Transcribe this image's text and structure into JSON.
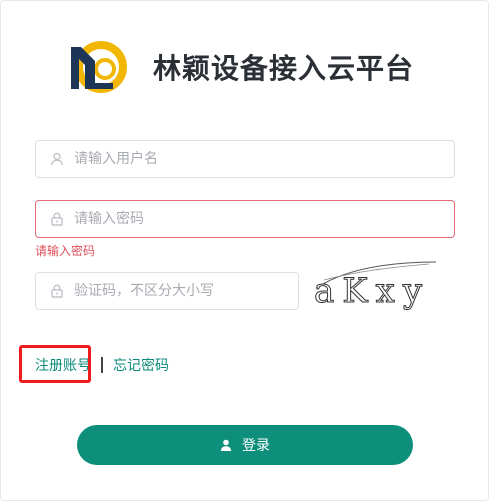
{
  "brand": {
    "title": "林颖设备接入云平台",
    "logo_icon": "brand-logo-icon",
    "colors": {
      "navy": "#1d3557",
      "gold": "#f2b705"
    }
  },
  "form": {
    "username": {
      "placeholder": "请输入用户名",
      "value": "",
      "icon": "user-icon"
    },
    "password": {
      "placeholder": "请输入密码",
      "value": "",
      "icon": "lock-icon",
      "error": "请输入密码"
    },
    "captcha": {
      "placeholder": "验证码，不区分大小写",
      "value": "",
      "icon": "lock-icon",
      "image_text": "aKxy"
    }
  },
  "links": {
    "register": "注册账号",
    "separator": "|",
    "forgot": "忘记密码"
  },
  "login_button": {
    "label": "登录",
    "icon": "user-icon",
    "color": "#0d8f7c"
  },
  "colors": {
    "error": "#e0505a",
    "link": "#0b8a7a",
    "highlight": "#ee1c1c"
  }
}
